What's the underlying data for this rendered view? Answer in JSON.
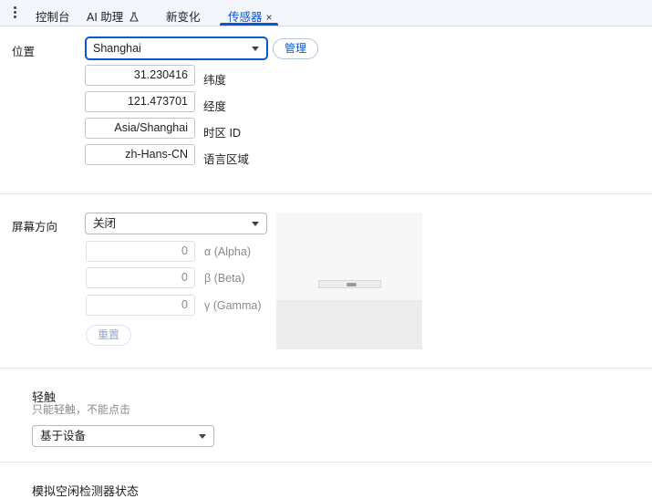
{
  "tabs": [
    {
      "label": "控制台"
    },
    {
      "label": "AI 助理",
      "suffix_icon": "beaker-icon"
    },
    {
      "label": "新变化"
    },
    {
      "label": "传感器",
      "active": true,
      "close": "×"
    }
  ],
  "location": {
    "label": "位置",
    "selected": "Shanghai",
    "manage_label": "管理",
    "latitude": {
      "value": "31.230416",
      "label": "纬度"
    },
    "longitude": {
      "value": "121.473701",
      "label": "经度"
    },
    "timezone": {
      "value": "Asia/Shanghai",
      "label": "时区 ID"
    },
    "locale": {
      "value": "zh-Hans-CN",
      "label": "语言区域"
    }
  },
  "orientation": {
    "label": "屏幕方向",
    "selected": "关闭",
    "alpha": {
      "value": "0",
      "label": "α (Alpha)"
    },
    "beta": {
      "value": "0",
      "label": "β (Beta)"
    },
    "gamma": {
      "value": "0",
      "label": "γ (Gamma)"
    },
    "reset_label": "重置"
  },
  "touch": {
    "title": "轻触",
    "subtitle": "只能轻触，不能点击",
    "selected": "基于设备"
  },
  "idle": {
    "title": "模拟空闲检测器状态"
  },
  "colors": {
    "accent": "#0b57d0",
    "tabbar_bg": "#f3f6fc"
  }
}
